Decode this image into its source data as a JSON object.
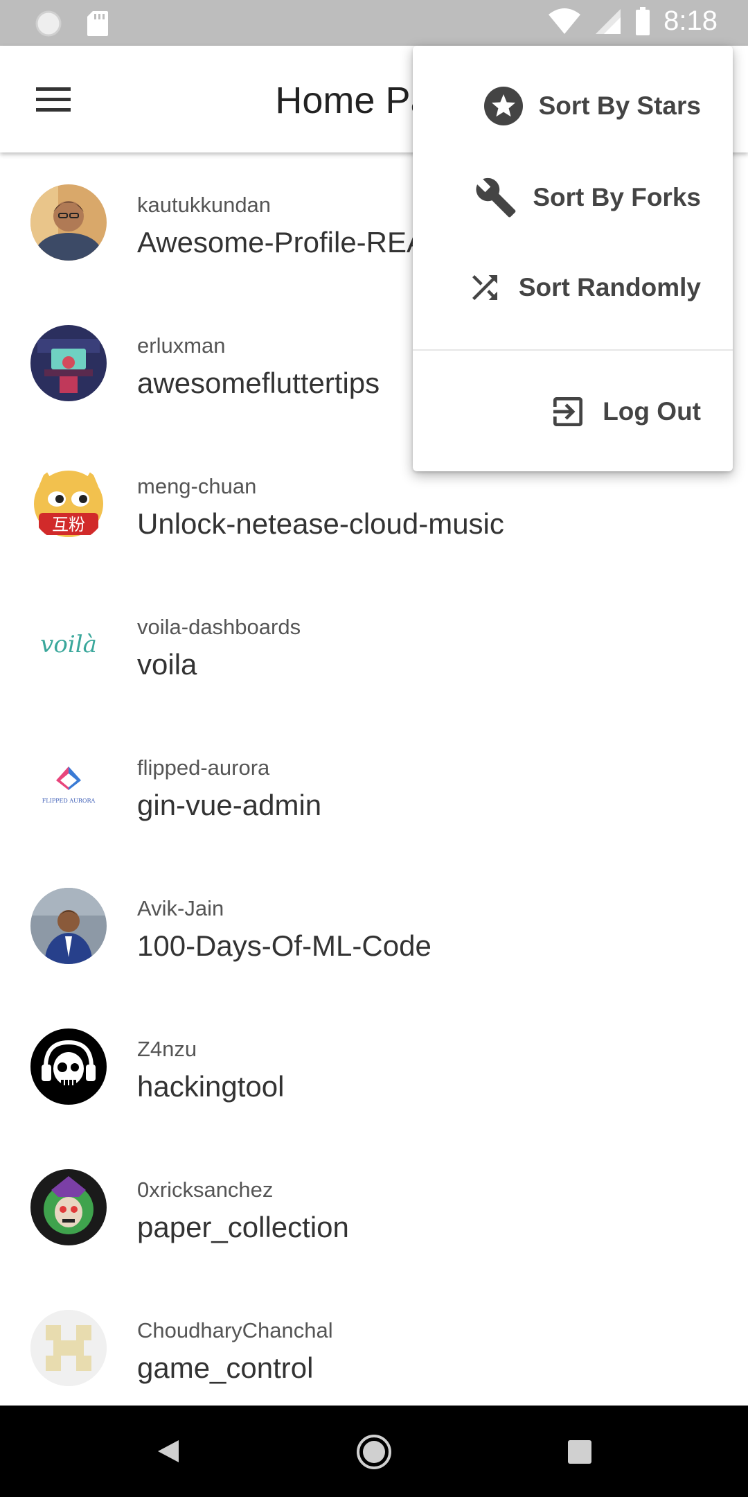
{
  "status_bar": {
    "time": "8:18",
    "icons": [
      "circle-icon",
      "sd-card-icon",
      "wifi-icon",
      "cell-signal-icon",
      "battery-icon"
    ]
  },
  "app_bar": {
    "title": "Home Page",
    "menu_icon": "menu-icon"
  },
  "repos": [
    {
      "owner": "kautukkundan",
      "name": "Awesome-Profile-README-templates"
    },
    {
      "owner": "erluxman",
      "name": "awesomefluttertips"
    },
    {
      "owner": "meng-chuan",
      "name": "Unlock-netease-cloud-music"
    },
    {
      "owner": "voila-dashboards",
      "name": "voila"
    },
    {
      "owner": "flipped-aurora",
      "name": "gin-vue-admin"
    },
    {
      "owner": "Avik-Jain",
      "name": "100-Days-Of-ML-Code"
    },
    {
      "owner": "Z4nzu",
      "name": "hackingtool"
    },
    {
      "owner": "0xricksanchez",
      "name": "paper_collection"
    },
    {
      "owner": "ChoudharyChanchal",
      "name": "game_control"
    }
  ],
  "avatar_labels": {
    "meng_chuan": "互粉",
    "voila": "voilà",
    "flipped_aurora": "FLIPPED AURORA"
  },
  "popup_menu": {
    "sort_stars": "Sort By Stars",
    "sort_forks": "Sort By Forks",
    "sort_random": "Sort Randomly",
    "log_out": "Log Out"
  },
  "nav_bar": {
    "icons": [
      "back-icon",
      "home-icon",
      "recents-icon"
    ]
  }
}
